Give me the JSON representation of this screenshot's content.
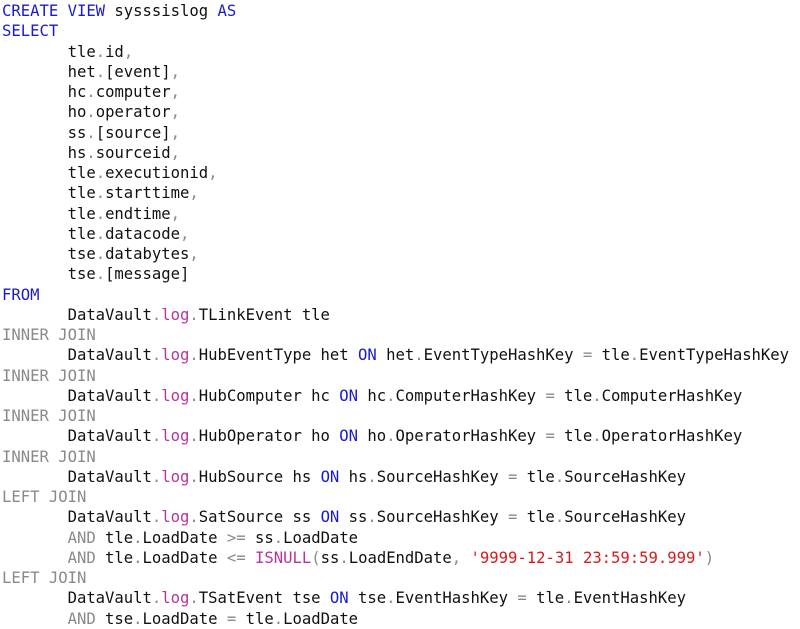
{
  "colors": {
    "keyword": "#1a1ad6",
    "join": "#8a8a8a",
    "operator": "#8a8a8a",
    "function": "#b8339e",
    "string": "#d81b1b",
    "text": "#111111"
  },
  "lines": [
    [
      [
        "k",
        "CREATE VIEW"
      ],
      [
        "x",
        " sysssislog "
      ],
      [
        "k",
        "AS"
      ]
    ],
    [
      [
        "k",
        "SELECT"
      ]
    ],
    [
      [
        "x",
        "       tle"
      ],
      [
        "p",
        "."
      ],
      [
        "x",
        "id"
      ],
      [
        "p",
        ","
      ]
    ],
    [
      [
        "x",
        "       het"
      ],
      [
        "p",
        "."
      ],
      [
        "x",
        "[event]"
      ],
      [
        "p",
        ","
      ]
    ],
    [
      [
        "x",
        "       hc"
      ],
      [
        "p",
        "."
      ],
      [
        "x",
        "computer"
      ],
      [
        "p",
        ","
      ]
    ],
    [
      [
        "x",
        "       ho"
      ],
      [
        "p",
        "."
      ],
      [
        "x",
        "operator"
      ],
      [
        "p",
        ","
      ]
    ],
    [
      [
        "x",
        "       ss"
      ],
      [
        "p",
        "."
      ],
      [
        "x",
        "[source]"
      ],
      [
        "p",
        ","
      ]
    ],
    [
      [
        "x",
        "       hs"
      ],
      [
        "p",
        "."
      ],
      [
        "x",
        "sourceid"
      ],
      [
        "p",
        ","
      ]
    ],
    [
      [
        "x",
        "       tle"
      ],
      [
        "p",
        "."
      ],
      [
        "x",
        "executionid"
      ],
      [
        "p",
        ","
      ]
    ],
    [
      [
        "x",
        "       tle"
      ],
      [
        "p",
        "."
      ],
      [
        "x",
        "starttime"
      ],
      [
        "p",
        ","
      ]
    ],
    [
      [
        "x",
        "       tle"
      ],
      [
        "p",
        "."
      ],
      [
        "x",
        "endtime"
      ],
      [
        "p",
        ","
      ]
    ],
    [
      [
        "x",
        "       tle"
      ],
      [
        "p",
        "."
      ],
      [
        "x",
        "datacode"
      ],
      [
        "p",
        ","
      ]
    ],
    [
      [
        "x",
        "       tse"
      ],
      [
        "p",
        "."
      ],
      [
        "x",
        "databytes"
      ],
      [
        "p",
        ","
      ]
    ],
    [
      [
        "x",
        "       tse"
      ],
      [
        "p",
        "."
      ],
      [
        "x",
        "[message]"
      ]
    ],
    [
      [
        "k",
        "FROM"
      ]
    ],
    [
      [
        "x",
        "       DataVault"
      ],
      [
        "p",
        "."
      ],
      [
        "m",
        "log"
      ],
      [
        "p",
        "."
      ],
      [
        "x",
        "TLinkEvent tle"
      ]
    ],
    [
      [
        "g",
        "INNER JOIN"
      ]
    ],
    [
      [
        "x",
        "       DataVault"
      ],
      [
        "p",
        "."
      ],
      [
        "m",
        "log"
      ],
      [
        "p",
        "."
      ],
      [
        "x",
        "HubEventType het "
      ],
      [
        "k",
        "ON"
      ],
      [
        "x",
        " het"
      ],
      [
        "p",
        "."
      ],
      [
        "x",
        "EventTypeHashKey "
      ],
      [
        "p",
        "="
      ],
      [
        "x",
        " tle"
      ],
      [
        "p",
        "."
      ],
      [
        "x",
        "EventTypeHashKey"
      ]
    ],
    [
      [
        "g",
        "INNER JOIN"
      ]
    ],
    [
      [
        "x",
        "       DataVault"
      ],
      [
        "p",
        "."
      ],
      [
        "m",
        "log"
      ],
      [
        "p",
        "."
      ],
      [
        "x",
        "HubComputer hc "
      ],
      [
        "k",
        "ON"
      ],
      [
        "x",
        " hc"
      ],
      [
        "p",
        "."
      ],
      [
        "x",
        "ComputerHashKey "
      ],
      [
        "p",
        "="
      ],
      [
        "x",
        " tle"
      ],
      [
        "p",
        "."
      ],
      [
        "x",
        "ComputerHashKey"
      ]
    ],
    [
      [
        "g",
        "INNER JOIN"
      ]
    ],
    [
      [
        "x",
        "       DataVault"
      ],
      [
        "p",
        "."
      ],
      [
        "m",
        "log"
      ],
      [
        "p",
        "."
      ],
      [
        "x",
        "HubOperator ho "
      ],
      [
        "k",
        "ON"
      ],
      [
        "x",
        " ho"
      ],
      [
        "p",
        "."
      ],
      [
        "x",
        "OperatorHashKey "
      ],
      [
        "p",
        "="
      ],
      [
        "x",
        " tle"
      ],
      [
        "p",
        "."
      ],
      [
        "x",
        "OperatorHashKey"
      ]
    ],
    [
      [
        "g",
        "INNER JOIN"
      ]
    ],
    [
      [
        "x",
        "       DataVault"
      ],
      [
        "p",
        "."
      ],
      [
        "m",
        "log"
      ],
      [
        "p",
        "."
      ],
      [
        "x",
        "HubSource hs "
      ],
      [
        "k",
        "ON"
      ],
      [
        "x",
        " hs"
      ],
      [
        "p",
        "."
      ],
      [
        "x",
        "SourceHashKey "
      ],
      [
        "p",
        "="
      ],
      [
        "x",
        " tle"
      ],
      [
        "p",
        "."
      ],
      [
        "x",
        "SourceHashKey"
      ]
    ],
    [
      [
        "g",
        "LEFT JOIN"
      ]
    ],
    [
      [
        "x",
        "       DataVault"
      ],
      [
        "p",
        "."
      ],
      [
        "m",
        "log"
      ],
      [
        "p",
        "."
      ],
      [
        "x",
        "SatSource ss "
      ],
      [
        "k",
        "ON"
      ],
      [
        "x",
        " ss"
      ],
      [
        "p",
        "."
      ],
      [
        "x",
        "SourceHashKey "
      ],
      [
        "p",
        "="
      ],
      [
        "x",
        " tle"
      ],
      [
        "p",
        "."
      ],
      [
        "x",
        "SourceHashKey"
      ]
    ],
    [
      [
        "x",
        "       "
      ],
      [
        "g",
        "AND"
      ],
      [
        "x",
        " tle"
      ],
      [
        "p",
        "."
      ],
      [
        "x",
        "LoadDate "
      ],
      [
        "p",
        ">="
      ],
      [
        "x",
        " ss"
      ],
      [
        "p",
        "."
      ],
      [
        "x",
        "LoadDate"
      ]
    ],
    [
      [
        "x",
        "       "
      ],
      [
        "g",
        "AND"
      ],
      [
        "x",
        " tle"
      ],
      [
        "p",
        "."
      ],
      [
        "x",
        "LoadDate "
      ],
      [
        "p",
        "<="
      ],
      [
        "x",
        " "
      ],
      [
        "m",
        "ISNULL"
      ],
      [
        "p",
        "("
      ],
      [
        "x",
        "ss"
      ],
      [
        "p",
        "."
      ],
      [
        "x",
        "LoadEndDate"
      ],
      [
        "p",
        ","
      ],
      [
        "x",
        " "
      ],
      [
        "s",
        "'9999-12-31 23:59:59.999'"
      ],
      [
        "p",
        ")"
      ]
    ],
    [
      [
        "g",
        "LEFT JOIN"
      ]
    ],
    [
      [
        "x",
        "       DataVault"
      ],
      [
        "p",
        "."
      ],
      [
        "m",
        "log"
      ],
      [
        "p",
        "."
      ],
      [
        "x",
        "TSatEvent tse "
      ],
      [
        "k",
        "ON"
      ],
      [
        "x",
        " tse"
      ],
      [
        "p",
        "."
      ],
      [
        "x",
        "EventHashKey "
      ],
      [
        "p",
        "="
      ],
      [
        "x",
        " tle"
      ],
      [
        "p",
        "."
      ],
      [
        "x",
        "EventHashKey"
      ]
    ],
    [
      [
        "x",
        "       "
      ],
      [
        "g",
        "AND"
      ],
      [
        "x",
        " tse"
      ],
      [
        "p",
        "."
      ],
      [
        "x",
        "LoadDate "
      ],
      [
        "p",
        "="
      ],
      [
        "x",
        " tle"
      ],
      [
        "p",
        "."
      ],
      [
        "x",
        "LoadDate"
      ]
    ]
  ]
}
